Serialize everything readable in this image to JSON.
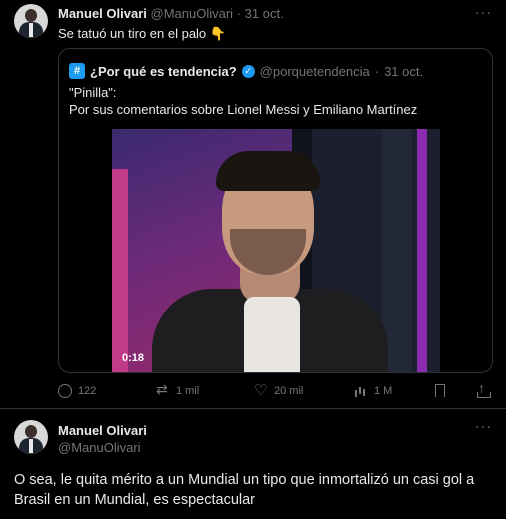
{
  "tweet1": {
    "author_name": "Manuel Olivari",
    "handle": "@ManuOlivari",
    "separator": "·",
    "date": "31 oct.",
    "text": "Se tatuó un tiro en el palo",
    "emoji": "👇",
    "more": "···",
    "quote": {
      "logo_glyph": "#",
      "author_name": "¿Por qué es tendencia?",
      "verified_glyph": "✓",
      "handle": "@porquetendencia",
      "separator": "·",
      "date": "31 oct.",
      "line1": "\"Pinilla\":",
      "line2": "Por sus comentarios sobre Lionel Messi y Emiliano Martínez",
      "video_time": "0:18"
    },
    "actions": {
      "replies": "122",
      "retweets": "1 mil",
      "likes": "20 mil",
      "views": "1 M"
    }
  },
  "tweet2": {
    "author_name": "Manuel Olivari",
    "handle": "@ManuOlivari",
    "more": "···",
    "text": "O sea, le quita mérito a un Mundial un tipo que inmortalizó un casi gol a Brasil en un Mundial, es espectacular"
  }
}
